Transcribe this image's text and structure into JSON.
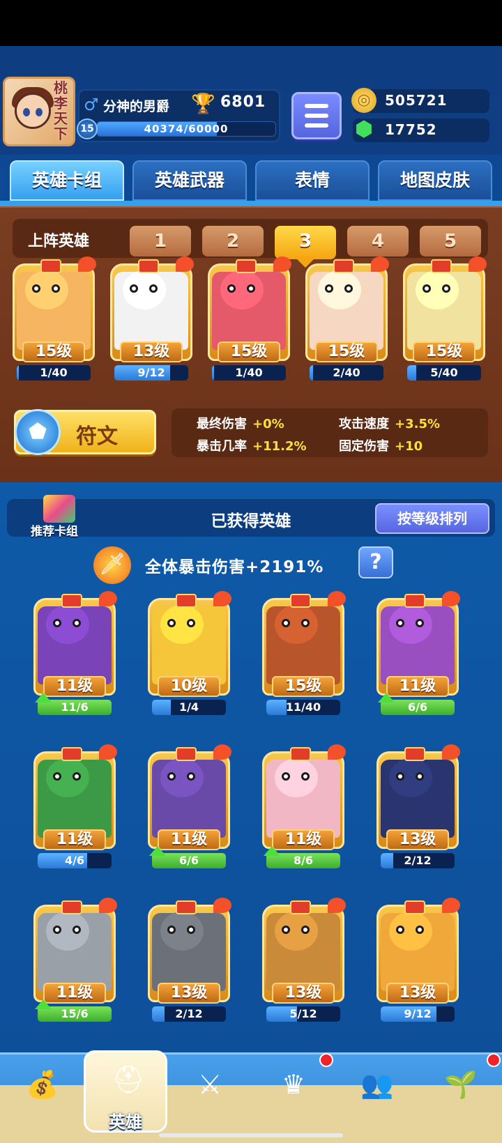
{
  "player": {
    "avatar_text": "桃李天下",
    "name": "分神的男爵",
    "trophies": "6801",
    "level": "15",
    "xp_text": "40374/60000",
    "xp_fraction": 0.673
  },
  "currency": {
    "gold": "505721",
    "gems": "17752"
  },
  "tabs": [
    "英雄卡组",
    "英雄武器",
    "表情",
    "地图皮肤"
  ],
  "lineup": {
    "title": "上阵英雄",
    "slots": [
      "1",
      "2",
      "3",
      "4",
      "5"
    ],
    "active_slot": 3,
    "cards": [
      {
        "level": "15级",
        "progress": "1/40",
        "fraction": 0.025,
        "color": "#f6b561"
      },
      {
        "level": "13级",
        "progress": "9/12",
        "fraction": 0.75,
        "color": "#f2f2f2"
      },
      {
        "level": "15级",
        "progress": "1/40",
        "fraction": 0.025,
        "color": "#e55a6a"
      },
      {
        "level": "15级",
        "progress": "2/40",
        "fraction": 0.05,
        "color": "#f6d8c2"
      },
      {
        "level": "15级",
        "progress": "5/40",
        "fraction": 0.125,
        "color": "#f1e2a0"
      }
    ]
  },
  "rune": {
    "label": "符文",
    "stats": [
      {
        "key": "最终伤害",
        "value": "+0%"
      },
      {
        "key": "攻击速度",
        "value": "+3.5%"
      },
      {
        "key": "暴击几率",
        "value": "+11.2%"
      },
      {
        "key": "固定伤害",
        "value": "+10"
      }
    ]
  },
  "collection": {
    "recommend_label": "推荐卡组",
    "title": "已获得英雄",
    "sort_label": "按等级排列",
    "crit_text": "全体暴击伤害+2191%",
    "help": "?",
    "cards": [
      {
        "level": "11级",
        "progress": "11/6",
        "fraction": 1,
        "upgrade": true,
        "color": "#7a43b8"
      },
      {
        "level": "10级",
        "progress": "1/4",
        "fraction": 0.25,
        "upgrade": false,
        "color": "#f5c63a"
      },
      {
        "level": "15级",
        "progress": "11/40",
        "fraction": 0.275,
        "upgrade": false,
        "color": "#b9552a"
      },
      {
        "level": "11级",
        "progress": "6/6",
        "fraction": 1,
        "upgrade": true,
        "color": "#9a4fc0"
      },
      {
        "level": "11级",
        "progress": "4/6",
        "fraction": 0.667,
        "upgrade": false,
        "color": "#3c9a46"
      },
      {
        "level": "11级",
        "progress": "6/6",
        "fraction": 1,
        "upgrade": true,
        "color": "#6a4aa8"
      },
      {
        "level": "11级",
        "progress": "8/6",
        "fraction": 1,
        "upgrade": true,
        "color": "#f1b7c4"
      },
      {
        "level": "13级",
        "progress": "2/12",
        "fraction": 0.167,
        "upgrade": false,
        "color": "#2a3570"
      },
      {
        "level": "11级",
        "progress": "15/6",
        "fraction": 1,
        "upgrade": true,
        "color": "#9aa0a8"
      },
      {
        "level": "13级",
        "progress": "2/12",
        "fraction": 0.167,
        "upgrade": false,
        "color": "#6c7078"
      },
      {
        "level": "13级",
        "progress": "5/12",
        "fraction": 0.417,
        "upgrade": false,
        "color": "#c98b3a"
      },
      {
        "level": "13级",
        "progress": "9/12",
        "fraction": 0.75,
        "upgrade": false,
        "color": "#f0a83a"
      }
    ]
  },
  "nav": {
    "items": [
      {
        "name": "shop",
        "icon": "treasure-chest-icon",
        "glyph": "💰",
        "label": "",
        "badge": false
      },
      {
        "name": "heroes",
        "icon": "knight-helmet-icon",
        "glyph": "⛑",
        "label": "英雄",
        "badge": false
      },
      {
        "name": "battle",
        "icon": "crossed-swords-icon",
        "glyph": "⚔",
        "label": "",
        "badge": false
      },
      {
        "name": "ranking",
        "icon": "crown-shield-icon",
        "glyph": "♛",
        "label": "",
        "badge": true
      },
      {
        "name": "social",
        "icon": "people-banner-icon",
        "glyph": "👥",
        "label": "",
        "badge": false
      },
      {
        "name": "garden",
        "icon": "sprout-icon",
        "glyph": "🌱",
        "label": "",
        "badge": true
      }
    ]
  }
}
